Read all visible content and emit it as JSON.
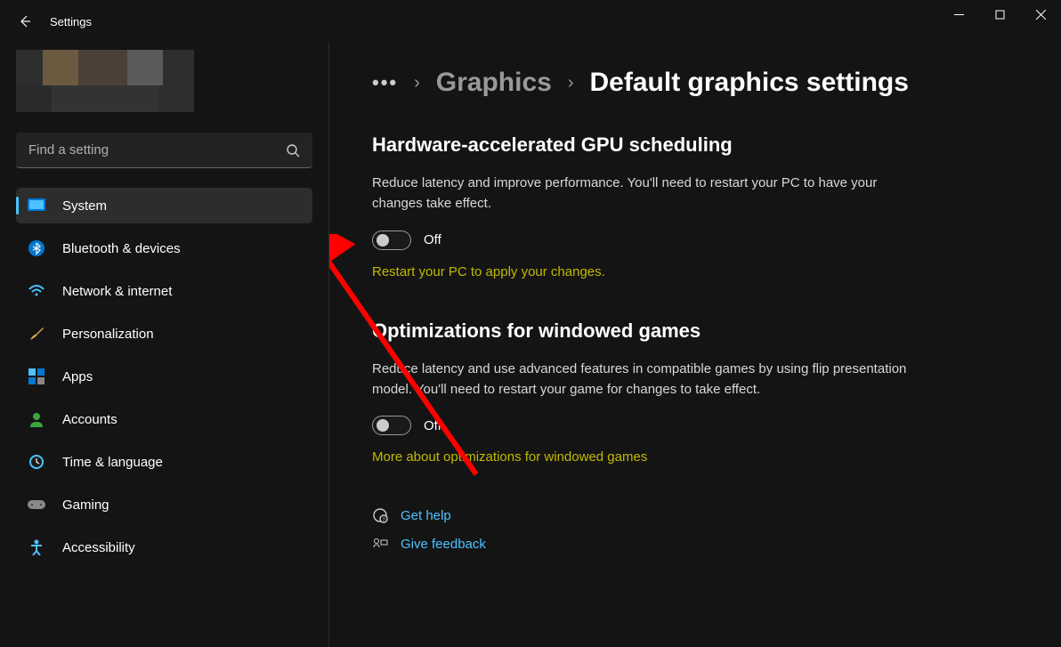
{
  "app": {
    "title": "Settings"
  },
  "search": {
    "placeholder": "Find a setting"
  },
  "nav": {
    "items": [
      {
        "label": "System"
      },
      {
        "label": "Bluetooth & devices"
      },
      {
        "label": "Network & internet"
      },
      {
        "label": "Personalization"
      },
      {
        "label": "Apps"
      },
      {
        "label": "Accounts"
      },
      {
        "label": "Time & language"
      },
      {
        "label": "Gaming"
      },
      {
        "label": "Accessibility"
      }
    ]
  },
  "breadcrumb": {
    "link": "Graphics",
    "current": "Default graphics settings"
  },
  "section1": {
    "title": "Hardware-accelerated GPU scheduling",
    "desc": "Reduce latency and improve performance. You'll need to restart your PC to have your changes take effect.",
    "toggle_state": "Off",
    "restart": "Restart your PC to apply your changes."
  },
  "section2": {
    "title": "Optimizations for windowed games",
    "desc": "Reduce latency and use advanced features in compatible games by using flip presentation model. You'll need to restart your game for changes to take effect.",
    "toggle_state": "Off",
    "link": "More about optimizations for windowed games"
  },
  "footer": {
    "help": "Get help",
    "feedback": "Give feedback"
  }
}
